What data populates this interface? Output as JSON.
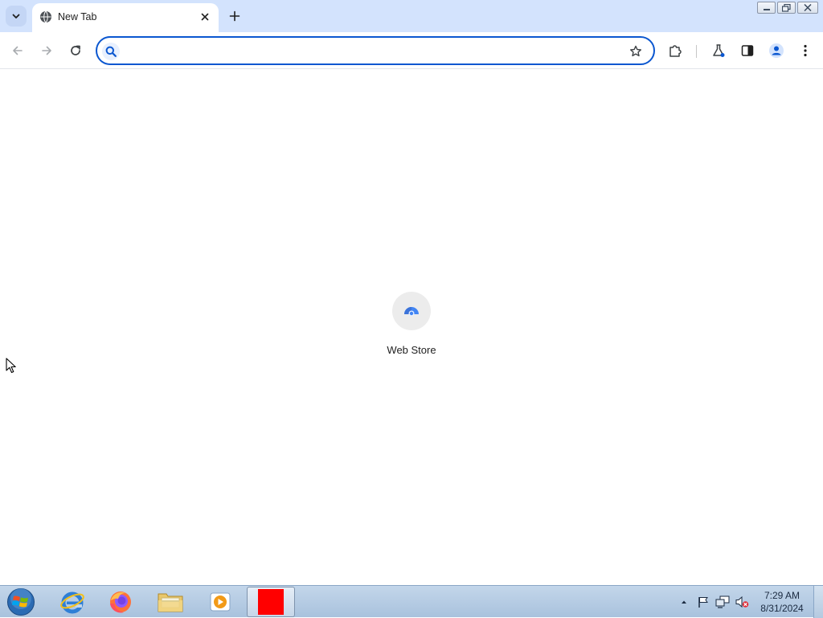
{
  "window": {
    "tab_title": "New Tab",
    "controls": [
      "minimize-icon",
      "restore-icon",
      "close-icon"
    ]
  },
  "toolbar": {
    "omnibox": {
      "value": "",
      "placeholder": ""
    },
    "icons": [
      "back-arrow-icon",
      "forward-arrow-icon",
      "reload-icon",
      "search-icon",
      "bookmark-star-icon",
      "extensions-icon",
      "labs-flask-icon",
      "side-panel-icon",
      "profile-icon",
      "menu-kebab-icon"
    ]
  },
  "content": {
    "shortcuts": [
      {
        "label": "Web Store",
        "icon": "web-store-icon"
      }
    ]
  },
  "taskbar": {
    "apps": [
      "windows-start-icon",
      "internet-explorer-icon",
      "firefox-icon",
      "file-explorer-icon",
      "media-player-icon",
      "chrome-window-icon"
    ],
    "tray_icons": [
      "show-hidden-icons-icon",
      "action-center-flag-icon",
      "network-icon",
      "volume-muted-icon"
    ],
    "clock": {
      "time": "7:29 AM",
      "date": "8/31/2024"
    }
  },
  "colors": {
    "tabstrip": "#d3e3fd",
    "accent": "#0b57d0",
    "active_taskbar_app": "#ff0000"
  }
}
